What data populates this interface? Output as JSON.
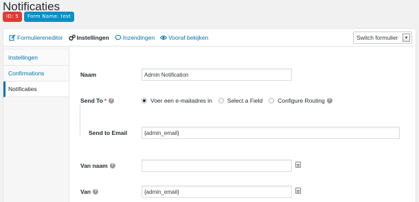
{
  "page": {
    "title": "Notificaties"
  },
  "badges": {
    "id": "ID: 5",
    "form_name": "Form Name: test"
  },
  "toolbar": {
    "items": [
      {
        "label": "Formuliereneditor",
        "icon": "edit-icon"
      },
      {
        "label": "Instellingen",
        "icon": "gears-icon"
      },
      {
        "label": "Inzendingen",
        "icon": "comment-icon"
      },
      {
        "label": "Vooraf bekijken",
        "icon": "eye-icon"
      }
    ],
    "switch_label": "Switch formulier"
  },
  "sidebar": {
    "items": [
      {
        "label": "Instellingen"
      },
      {
        "label": "Confirmations"
      },
      {
        "label": "Notificaties"
      }
    ]
  },
  "form": {
    "naam_label": "Naam",
    "naam_value": "Admin Notification",
    "send_to_label": "Send To",
    "send_to_required": "*",
    "send_to_options": [
      "Voer een e-mailadres in",
      "Select a Field",
      "Configure Routing"
    ],
    "send_to_email_label": "Send to Email",
    "send_to_email_value": "{admin_email}",
    "van_naam_label": "Van naam",
    "van_naam_value": "",
    "van_label": "Van",
    "van_value": "{admin_email}"
  },
  "colors": {
    "accent": "#0073aa",
    "badge_id": "#dd3d36",
    "badge_form": "#0e8fc4"
  }
}
